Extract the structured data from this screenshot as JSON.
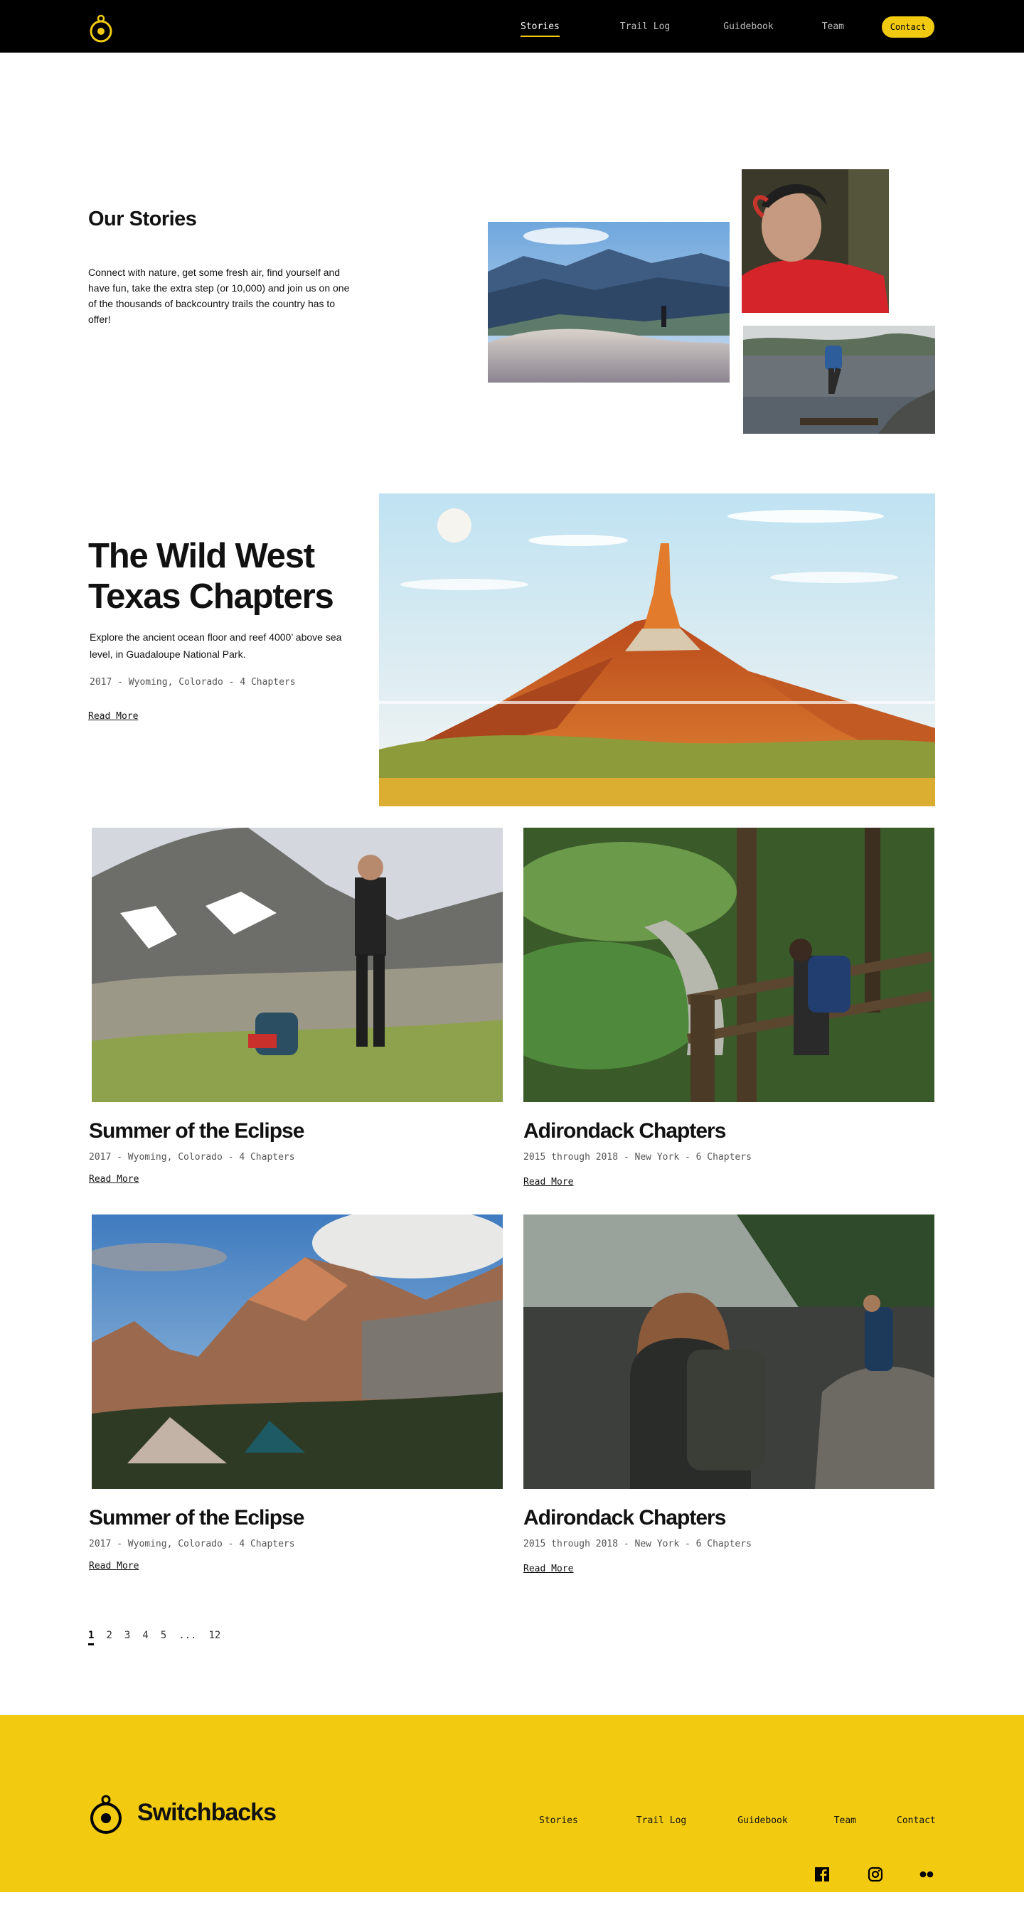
{
  "nav": {
    "links": [
      "Stories",
      "Trail Log",
      "Guidebook",
      "Team"
    ],
    "contact_label": "Contact",
    "logo_icon": "compass-logo-icon"
  },
  "hero": {
    "title": "Our Stories",
    "body": "Connect with nature, get some fresh air, find yourself and have fun, take the extra step (or 10,000) and join us on one of the thousands of backcountry trails the country has to offer!"
  },
  "feature": {
    "title": "The Wild West Texas Chapters",
    "description": "Explore the ancient ocean floor and reef 4000’ above sea level, in Guadaloupe National Park.",
    "meta": "2017  -  Wyoming, Colorado  -  4 Chapters",
    "read_more": "Read More"
  },
  "cards": [
    {
      "title": "Summer of the Eclipse",
      "meta": "2017  -  Wyoming, Colorado  -  4 Chapters",
      "read_more": "Read More"
    },
    {
      "title": "Adirondack Chapters",
      "meta": "2015 through 2018  -  New York  -  6 Chapters",
      "read_more": "Read More"
    },
    {
      "title": "Summer of the Eclipse",
      "meta": "2017  -  Wyoming, Colorado  -  4 Chapters",
      "read_more": "Read More"
    },
    {
      "title": "Adirondack Chapters",
      "meta": "2015 through 2018  -  New York  -  6 Chapters",
      "read_more": "Read More"
    }
  ],
  "pagination": {
    "current": "1",
    "pages": [
      "2",
      "3",
      "4",
      "5",
      "...",
      "12"
    ]
  },
  "footer": {
    "brand": "Switchbacks",
    "links": [
      "Stories",
      "Trail Log",
      "Guidebook",
      "Team",
      "Contact"
    ],
    "social_icons": [
      "facebook-icon",
      "instagram-icon",
      "flickr-icon"
    ]
  },
  "colors": {
    "accent": "#f2cb11",
    "nav_bg": "#000000"
  }
}
